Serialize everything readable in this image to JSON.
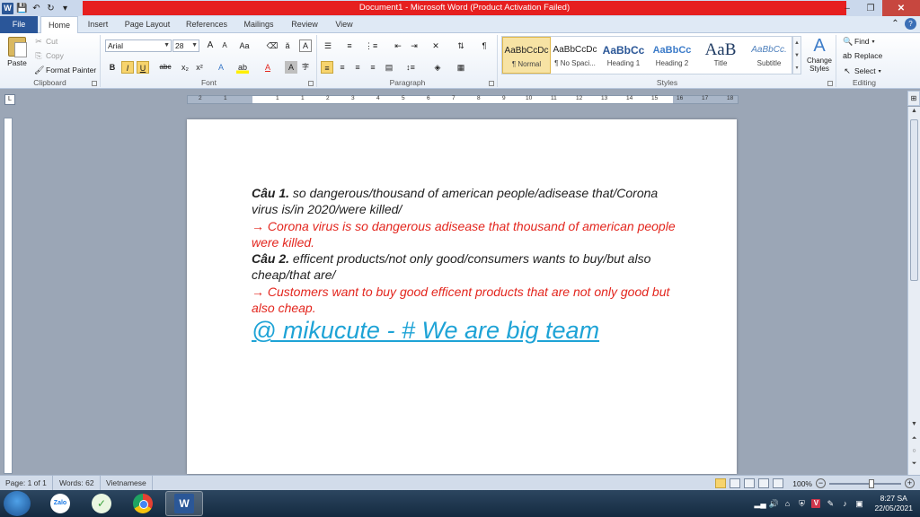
{
  "window": {
    "title": "Document1  -  Microsoft Word (Product Activation Failed)",
    "word_logo": "W"
  },
  "tabs": [
    "File",
    "Home",
    "Insert",
    "Page Layout",
    "References",
    "Mailings",
    "Review",
    "View"
  ],
  "clipboard": {
    "paste": "Paste",
    "cut": "Cut",
    "copy": "Copy",
    "format_painter": "Format Painter",
    "label": "Clipboard"
  },
  "font": {
    "name": "Arial",
    "size": "28",
    "label": "Font",
    "grow": "A",
    "shrink": "A",
    "case": "Aa",
    "bold": "B",
    "italic": "I",
    "underline": "U",
    "strike": "abc",
    "subscript": "x₂",
    "superscript": "x²",
    "effects": "A",
    "highlight": "ab",
    "color": "A",
    "shading": "A",
    "enclose": "字"
  },
  "paragraph": {
    "label": "Paragraph",
    "pilcrow": "¶"
  },
  "styles": {
    "label": "Styles",
    "items": [
      {
        "sample": "AaBbCcDc",
        "name": "¶ Normal"
      },
      {
        "sample": "AaBbCcDc",
        "name": "¶ No Spaci..."
      },
      {
        "sample": "AaBbCc",
        "name": "Heading 1"
      },
      {
        "sample": "AaBbCc",
        "name": "Heading 2"
      },
      {
        "sample": "AaB",
        "name": "Title"
      },
      {
        "sample": "AaBbCc.",
        "name": "Subtitle"
      }
    ],
    "change_styles": "Change Styles"
  },
  "editing": {
    "label": "Editing",
    "find": "Find",
    "replace": "Replace",
    "select": "Select"
  },
  "ruler_numbers": [
    "2",
    "1",
    "1",
    "1",
    "2",
    "3",
    "4",
    "5",
    "6",
    "7",
    "8",
    "9",
    "10",
    "11",
    "12",
    "13",
    "14",
    "15",
    "16",
    "17",
    "18",
    "19"
  ],
  "document": {
    "q1_label": "Câu 1.",
    "q1_text": " so dangerous/thousand of american people/adisease that/Corona virus is/in 2020/were killed/",
    "a1": "→ Corona virus is so dangerous adisease that thousand of american people were killed.",
    "q2_label": "Câu 2.",
    "q2_text": " efficent products/not only good/consumers wants to buy/but also cheap/that are/",
    "a2": "→ Customers want to buy good efficent products that are not only good but also cheap.",
    "watermark": "@ mikucute - # We are big team"
  },
  "status": {
    "page": "Page: 1 of 1",
    "words": "Words: 62",
    "language": "Vietnamese",
    "zoom": "100%",
    "zoom_value": 100
  },
  "taskbar": {
    "zalo": "Zalo",
    "time": "8:27 SA",
    "date": "22/05/2021",
    "v": "V"
  },
  "colors": {
    "answer": "#e3261e",
    "watermark": "#1ea3d6",
    "title_bar_warning": "#e61f1f",
    "file_tab": "#2a5699"
  }
}
